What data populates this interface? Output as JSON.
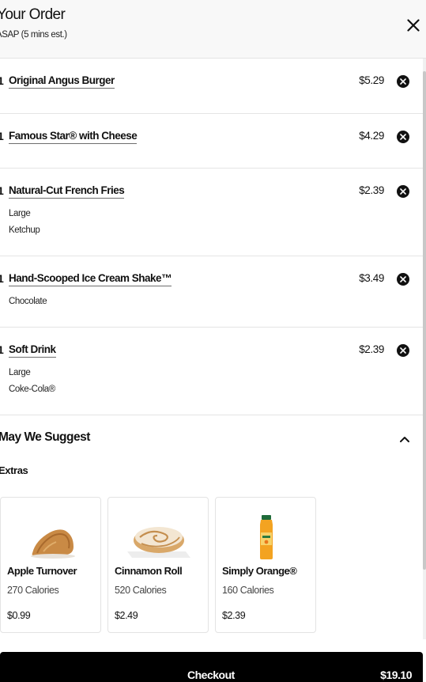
{
  "header": {
    "title": "Your Order",
    "subtitle": "ASAP (5 mins est.)",
    "close_icon": "close-icon"
  },
  "items": [
    {
      "qty": "1",
      "name": "Original Angus Burger",
      "price": "$5.29",
      "modifiers": []
    },
    {
      "qty": "1",
      "name": "Famous Star® with Cheese",
      "price": "$4.29",
      "modifiers": []
    },
    {
      "qty": "1",
      "name": "Natural-Cut French Fries",
      "price": "$2.39",
      "modifiers": [
        "Large",
        "Ketchup"
      ]
    },
    {
      "qty": "1",
      "name": "Hand-Scooped Ice Cream Shake™",
      "price": "$3.49",
      "modifiers": [
        "Chocolate"
      ]
    },
    {
      "qty": "1",
      "name": "Soft Drink",
      "price": "$2.39",
      "modifiers": [
        "Large",
        "Coke-Cola®"
      ]
    }
  ],
  "suggest": {
    "title": "May We Suggest",
    "section_label": "Extras",
    "cards": [
      {
        "name": "Apple Turnover",
        "calories": "270 Calories",
        "price": "$0.99",
        "image": "apple-turnover-image"
      },
      {
        "name": "Cinnamon Roll",
        "calories": "520 Calories",
        "price": "$2.49",
        "image": "cinnamon-roll-image"
      },
      {
        "name": "Simply Orange®",
        "calories": "160 Calories",
        "price": "$2.39",
        "image": "orange-juice-image"
      }
    ]
  },
  "checkout": {
    "label": "Checkout",
    "total": "$19.10"
  },
  "colors": {
    "text": "#111111",
    "checkout_bg": "#000000",
    "header_bg": "#f8f8f8",
    "divider": "#e4e4e4"
  }
}
